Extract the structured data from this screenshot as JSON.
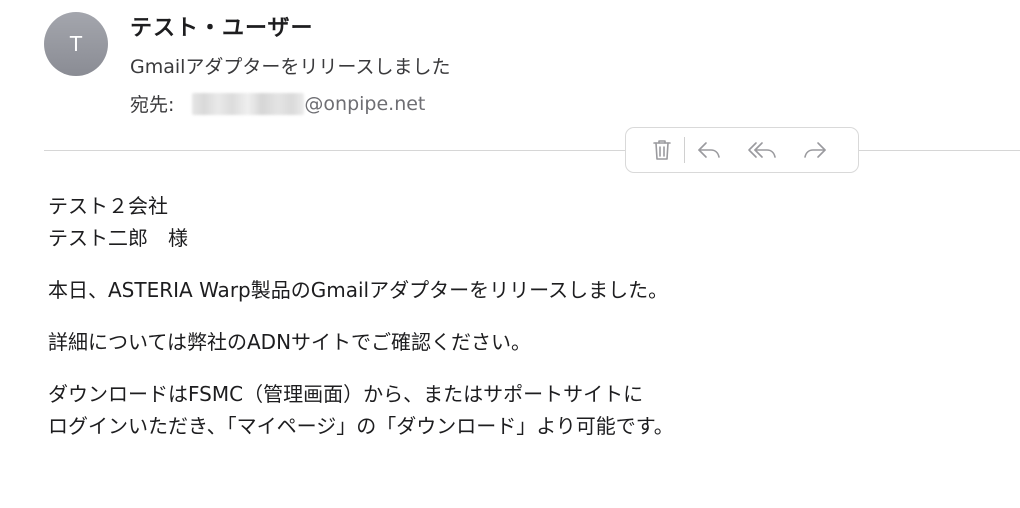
{
  "header": {
    "avatar_initial": "T",
    "sender_name": "テスト・ユーザー",
    "subject": "Gmailアダプターをリリースしました",
    "to_label": "宛先:",
    "to_domain": "@onpipe.net"
  },
  "toolbar": {
    "icons": [
      "trash-icon",
      "reply-icon",
      "reply-all-icon",
      "forward-icon"
    ]
  },
  "body": {
    "lines": [
      "テスト２会社",
      "テスト二郎　様",
      "本日、ASTERIA Warp製品のGmailアダプターをリリースしました。",
      "詳細については弊社のADNサイトでご確認ください。",
      "ダウンロードはFSMC（管理画面）から、またはサポートサイトに",
      "ログインいただき、「マイページ」の「ダウンロード」より可能です。"
    ]
  },
  "colors": {
    "avatar": "#9a9ca3",
    "text": "#1d1d1f",
    "secondary_text": "#3a3a3c",
    "icon": "#9a9a9e",
    "divider": "#d6d6d6"
  }
}
